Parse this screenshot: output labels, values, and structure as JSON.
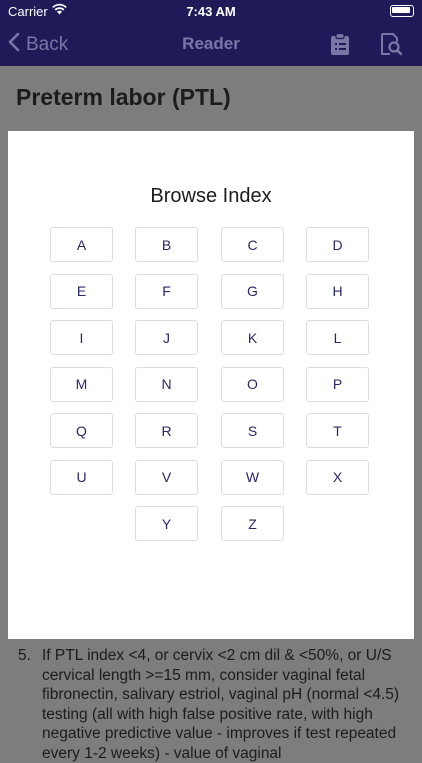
{
  "status": {
    "carrier": "Carrier",
    "time": "7:43 AM"
  },
  "nav": {
    "back_label": "Back",
    "title": "Reader"
  },
  "page": {
    "heading": "Preterm labor (PTL)",
    "list_item_number": "5.",
    "list_item_text": "If PTL index <4, or cervix <2 cm dil & <50%, or U/S cervical length >=15 mm, consider vaginal fetal fibronectin, salivary estriol, vaginal pH (normal <4.5) testing (all with high false positive rate, with high negative predictive value - improves if test repeated every 1-2 weeks) - value of vaginal"
  },
  "modal": {
    "title": "Browse Index",
    "letters": [
      "A",
      "B",
      "C",
      "D",
      "E",
      "F",
      "G",
      "H",
      "I",
      "J",
      "K",
      "L",
      "M",
      "N",
      "O",
      "P",
      "Q",
      "R",
      "S",
      "T",
      "U",
      "V",
      "W",
      "X",
      "Y",
      "Z"
    ]
  },
  "colors": {
    "nav_bg": "#1f1b58",
    "nav_text": "#7a77a6",
    "letter_text": "#2a2766",
    "overlay": "#7d7d7d"
  },
  "icons": {
    "back": "chevron-left-icon",
    "clipboard": "clipboard-icon",
    "search": "document-search-icon",
    "wifi": "wifi-icon",
    "battery": "battery-icon"
  }
}
